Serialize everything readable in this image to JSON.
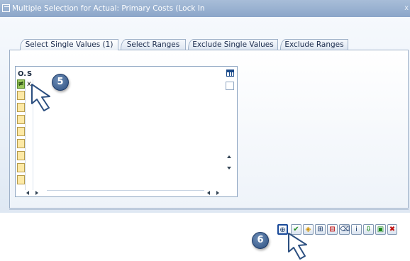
{
  "window": {
    "title": "Multiple Selection for Actual: Primary Costs (Lock In",
    "close_glyph": "x"
  },
  "tabs": [
    {
      "label": "Select Single Values (1)",
      "active": true
    },
    {
      "label": "Select Ranges",
      "active": false
    },
    {
      "label": "Exclude Single Values",
      "active": false
    },
    {
      "label": "Exclude Ranges",
      "active": false
    }
  ],
  "grid": {
    "headers": {
      "option": "O.",
      "single_value": "S"
    },
    "rows": [
      {
        "option": "≠",
        "value": "x"
      },
      {
        "option": "",
        "value": ""
      },
      {
        "option": "",
        "value": ""
      },
      {
        "option": "",
        "value": ""
      },
      {
        "option": "",
        "value": ""
      },
      {
        "option": "",
        "value": ""
      },
      {
        "option": "",
        "value": ""
      },
      {
        "option": "",
        "value": ""
      },
      {
        "option": "",
        "value": ""
      }
    ]
  },
  "callouts": {
    "step5": "5",
    "step6": "6"
  },
  "toolbar": {
    "buttons": [
      {
        "name": "execute-button",
        "icon": "clock-execute-icon",
        "glyph": "⊕"
      },
      {
        "name": "check-button",
        "icon": "checkmark-icon",
        "glyph": "✔"
      },
      {
        "name": "multiple-selection-button",
        "icon": "multi-select-icon",
        "glyph": "◈"
      },
      {
        "name": "insert-row-button",
        "icon": "insert-row-icon",
        "glyph": "⊞"
      },
      {
        "name": "delete-row-button",
        "icon": "delete-row-icon",
        "glyph": "⊟"
      },
      {
        "name": "delete-all-button",
        "icon": "trash-icon",
        "glyph": "⌫"
      },
      {
        "name": "info-button",
        "icon": "info-icon",
        "glyph": "i"
      },
      {
        "name": "import-button",
        "icon": "import-icon",
        "glyph": "⇩"
      },
      {
        "name": "paste-button",
        "icon": "paste-clipboard-icon",
        "glyph": "▣"
      },
      {
        "name": "cancel-button",
        "icon": "cancel-x-icon",
        "glyph": "✖"
      }
    ]
  },
  "colors": {
    "accent": "#2c4f80",
    "title_bar": "#8ba6c9",
    "tab_border": "#9fb1c8",
    "row_button": "#fde9a6",
    "exclude_button": "#98c65a"
  }
}
